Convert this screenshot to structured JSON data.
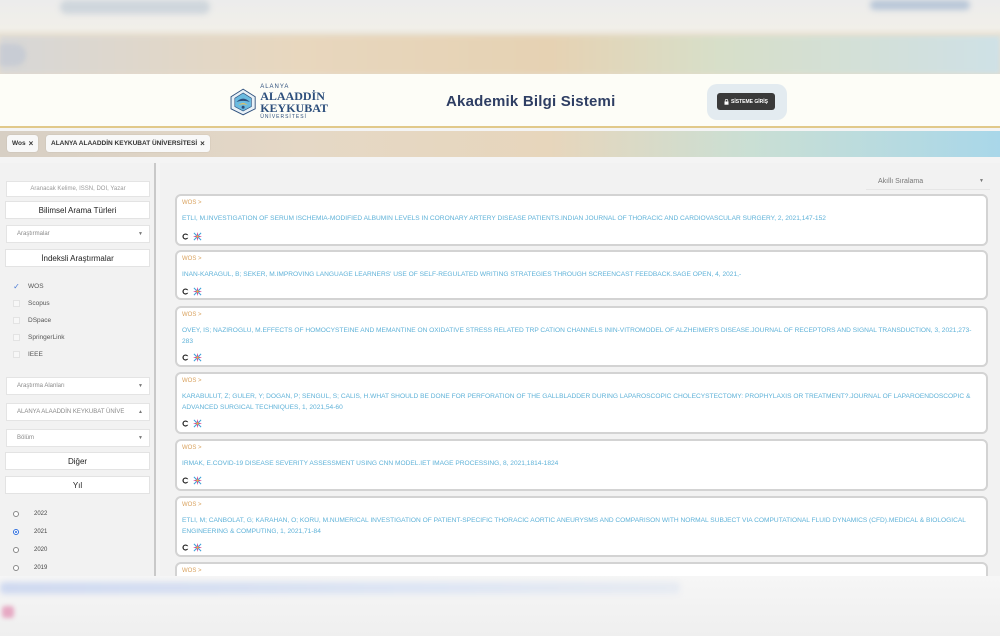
{
  "header": {
    "logo": {
      "line1": "ALANYA",
      "line2": "ALAADDİN",
      "line3": "KEYKUBAT",
      "line4": "ÜNİVERSİTESİ"
    },
    "title": "Akademik Bilgi Sistemi",
    "login_label": "SİSTEME GİRİŞ"
  },
  "filters": {
    "chips": [
      {
        "label": "Wos"
      },
      {
        "label": "ALANYA ALAADDİN KEYKUBAT ÜNİVERSİTESİ"
      }
    ]
  },
  "sidebar": {
    "search_placeholder": "Aranacak Kelime, ISSN, DOI, Yazar",
    "search_types_heading": "Bilimsel Arama Türleri",
    "research_select": "Araştırmalar",
    "indexed_heading": "İndeksli Araştırmalar",
    "sources": [
      {
        "label": "WOS",
        "checked": true
      },
      {
        "label": "Scopus",
        "checked": false
      },
      {
        "label": "DSpace",
        "checked": false
      },
      {
        "label": "SpringerLink",
        "checked": false
      },
      {
        "label": "IEEE",
        "checked": false
      }
    ],
    "field_select": "Araştırma Alanları",
    "university_select": "ALANYA ALAADDİN KEYKUBAT ÜNİVE",
    "department_select": "Bölüm",
    "other_heading": "Diğer",
    "year_heading": "Yıl",
    "years": [
      {
        "label": "2022",
        "selected": false
      },
      {
        "label": "2021",
        "selected": true
      },
      {
        "label": "2020",
        "selected": false
      },
      {
        "label": "2019",
        "selected": false
      }
    ]
  },
  "main": {
    "sort_label": "Akıllı Sıralama",
    "results": [
      {
        "source": "WOS >",
        "citation": "ETLI, M.INVESTIGATION OF SERUM ISCHEMIA-MODIFIED ALBUMIN LEVELS IN CORONARY ARTERY DISEASE PATIENTS.INDIAN JOURNAL OF THORACIC AND CARDIOVASCULAR SURGERY, 2, 2021,147-152"
      },
      {
        "source": "WOS >",
        "citation": "INAN-KARAGUL, B; SEKER, M.IMPROVING LANGUAGE LEARNERS' USE OF SELF-REGULATED WRITING STRATEGIES THROUGH SCREENCAST FEEDBACK.SAGE OPEN, 4, 2021,-"
      },
      {
        "source": "WOS >",
        "citation": "OVEY, IS; NAZIROGLU, M.EFFECTS OF HOMOCYSTEINE AND MEMANTINE ON OXIDATIVE STRESS RELATED TRP CATION CHANNELS ININ-VITROMODEL OF ALZHEIMER'S DISEASE.JOURNAL OF RECEPTORS AND SIGNAL TRANSDUCTION, 3, 2021,273-283"
      },
      {
        "source": "WOS >",
        "citation": "KARABULUT, Z; GULER, Y; DOGAN, P; SENGUL, S; CALIS, H.WHAT SHOULD BE DONE FOR PERFORATION OF THE GALLBLADDER DURING LAPAROSCOPIC CHOLECYSTECTOMY: PROPHYLAXIS OR TREATMENT?.JOURNAL OF LAPAROENDOSCOPIC & ADVANCED SURGICAL TECHNIQUES, 1, 2021,54-60"
      },
      {
        "source": "WOS >",
        "citation": "IRMAK, E.COVID-19 DISEASE SEVERITY ASSESSMENT USING CNN MODEL.IET IMAGE PROCESSING, 8, 2021,1814-1824"
      },
      {
        "source": "WOS >",
        "citation": "ETLI, M; CANBOLAT, G; KARAHAN, O; KORU, M.NUMERICAL INVESTIGATION OF PATIENT-SPECIFIC THORACIC AORTIC ANEURYSMS AND COMPARISON WITH NORMAL SUBJECT VIA COMPUTATIONAL FLUID DYNAMICS (CFD).MEDICAL & BIOLOGICAL ENGINEERING & COMPUTING, 1, 2021,71-84"
      },
      {
        "source": "WOS >",
        "citation": ""
      }
    ]
  },
  "colors": {
    "citation": "#5fb2d8",
    "source_tag": "#d9a25e",
    "title": "#2e3e63",
    "header_border": "#e1c98a",
    "checkbox_accent": "#4a7bd6"
  }
}
